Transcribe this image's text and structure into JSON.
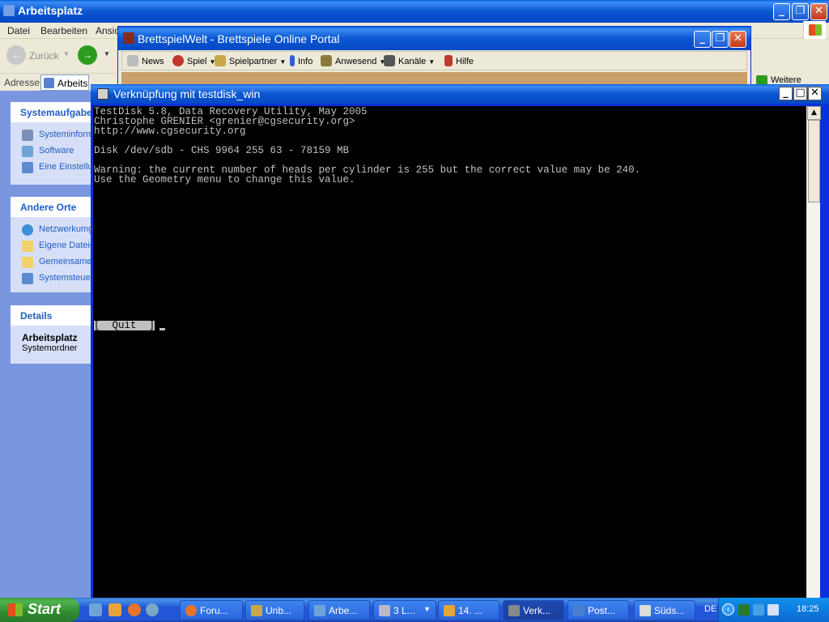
{
  "explorer": {
    "title": "Arbeitsplatz",
    "menu": [
      "Datei",
      "Bearbeiten",
      "Ansicht"
    ],
    "back_label": "Zurück",
    "address_label": "Adresse",
    "address_value": "Arbeitsplatz",
    "panels": {
      "system": {
        "title": "Systemaufgaben",
        "items": [
          "Systeminformationen anzeigen",
          "Software",
          "Eine Einstellung ändern"
        ]
      },
      "other": {
        "title": "Andere Orte",
        "items": [
          "Netzwerkumgebung",
          "Eigene Dateien",
          "Gemeinsame Dokumente",
          "Systemsteuerung"
        ]
      },
      "details": {
        "title": "Details",
        "name": "Arbeitsplatz",
        "subtitle": "Systemordner"
      }
    },
    "sidebar_link": "Weitere"
  },
  "bsw": {
    "title": "BrettspielWelt - Brettspiele Online Portal",
    "toolbar": [
      "News",
      "Spiel",
      "Spielpartner",
      "Info",
      "Anwesend",
      "Kanäle",
      "Hilfe"
    ]
  },
  "console": {
    "title": "Verknüpfung mit testdisk_win",
    "lines": [
      "TestDisk 5.8, Data Recovery Utility, May 2005",
      "Christophe GRENIER <grenier@cgsecurity.org>",
      "http://www.cgsecurity.org",
      "",
      "Disk /dev/sdb - CHS 9964 255 63 - 78159 MB",
      "",
      "Warning: the current number of heads per cylinder is 255 but the correct value may be 240.",
      "Use the Geometry menu to change this value."
    ],
    "quit_label": "[  Quit  ]"
  },
  "taskbar": {
    "start_label": "Start",
    "tasks": [
      "Foru...",
      "Unb...",
      "Arbe...",
      "3 L...",
      "14. ...",
      "Verk...",
      "Post...",
      "Süds..."
    ],
    "language": "DE",
    "clock": "18:25"
  },
  "colors": {
    "xp_blue": "#0a56d0",
    "terminal_bg": "#000000",
    "terminal_fg": "#c0c0c0",
    "taskbar": "#2355d5",
    "start_green": "#2f8a2f"
  }
}
